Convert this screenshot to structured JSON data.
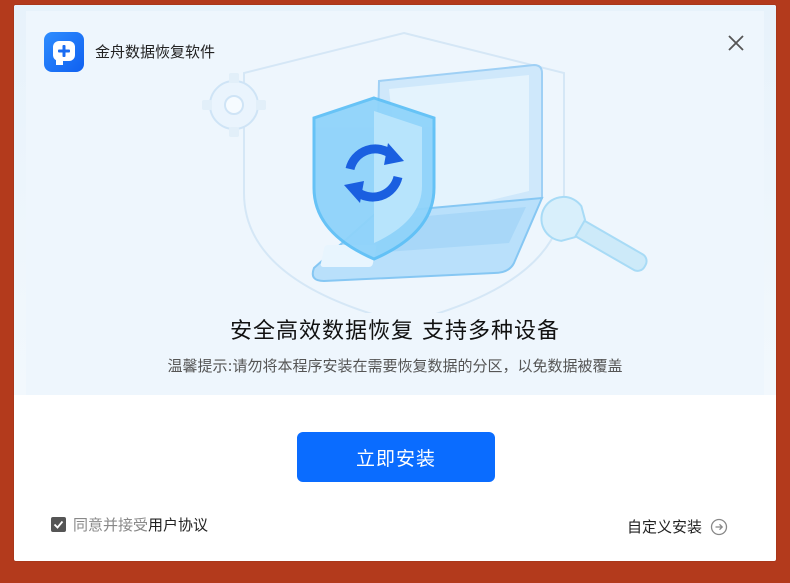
{
  "window": {
    "title": "金舟数据恢复软件",
    "close_icon": "close-icon",
    "logo_icon": "app-logo-icon"
  },
  "hero": {
    "headline": "安全高效数据恢复 支持多种设备",
    "hint": "温馨提示:请勿将本程序安装在需要恢复数据的分区，以免数据被覆盖"
  },
  "footer": {
    "install_label": "立即安装",
    "agree_prefix": "同意并接受",
    "agree_link": "用户协议",
    "agree_checked": true,
    "custom_install_label": "自定义安装"
  },
  "colors": {
    "primary": "#0a6cff",
    "frame": "#b33a1c",
    "hero_bg": "#eef6fd"
  }
}
